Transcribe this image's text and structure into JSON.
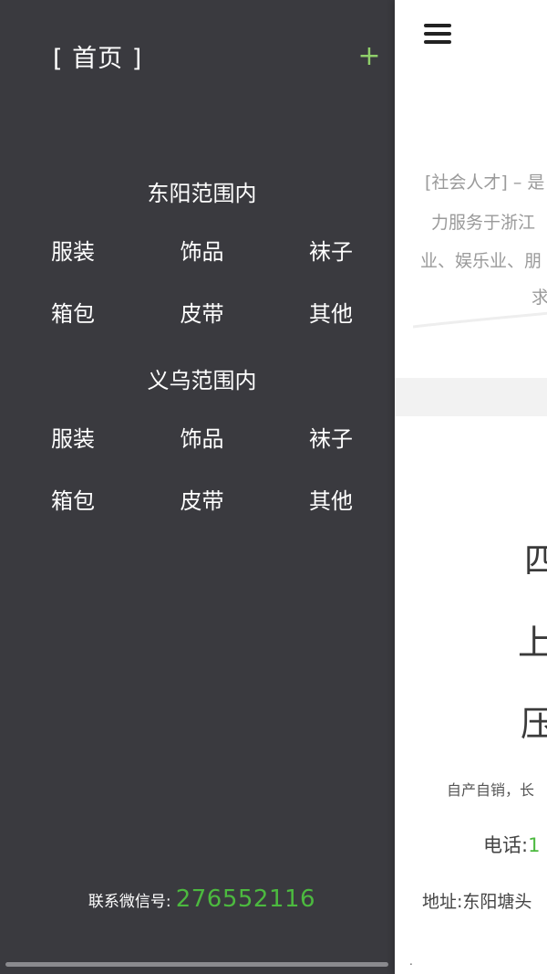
{
  "drawer": {
    "home_label": "[ 首页 ]",
    "add_icon_glyph": "+",
    "accent_color": "#8fcf6a",
    "sections": [
      {
        "title": "东阳范围内",
        "items": [
          "服装",
          "饰品",
          "袜子",
          "箱包",
          "皮带",
          "其他"
        ]
      },
      {
        "title": "义乌范围内",
        "items": [
          "服装",
          "饰品",
          "袜子",
          "箱包",
          "皮带",
          "其他"
        ]
      }
    ],
    "wechat_label": "联系微信号:",
    "wechat_value": "276552116",
    "wechat_color": "#4cb93f"
  },
  "main": {
    "menu_icon": "hamburger-menu-icon",
    "intro_lines": [
      "[社会人才] – 是",
      "力服务于浙江",
      "业、娱乐业、朋",
      "求"
    ],
    "big_chars": [
      "四",
      "上",
      "压"
    ],
    "desc": "自产自销，长",
    "phone_label": "电话:",
    "phone_value": "1",
    "address": "地址:东阳塘头",
    "footer_dot": "."
  }
}
